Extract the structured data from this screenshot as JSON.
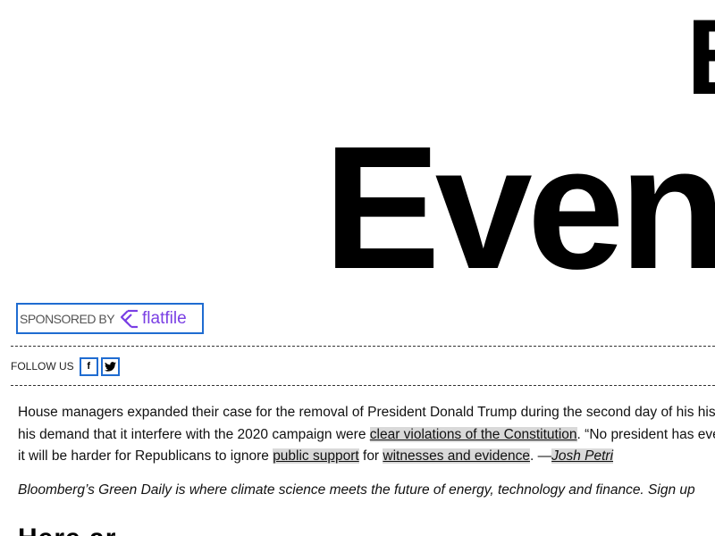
{
  "masthead": {
    "top_word": "B",
    "main_word": "Eveni"
  },
  "sponsor": {
    "label": "SPONSORED BY",
    "brand": "flatfile",
    "logo_icon": "flatfile-layers-icon",
    "border_color": "#1f6cd1",
    "brand_color": "#7a3fe4"
  },
  "follow": {
    "label": "FOLLOW US",
    "facebook_glyph": "f",
    "twitter_icon": "twitter-bird-icon"
  },
  "article": {
    "line1": "House managers expanded their case for the removal of President Donald Trump during the second day of his his",
    "line2_pre": "his demand that it interfere with the 2020 campaign were ",
    "line2_link": "clear violations of the Constitution",
    "line2_post": ". “No president has eve",
    "line3_pre": "it will be harder for Republicans to ignore ",
    "line3_link1": "public support",
    "line3_mid": " for ",
    "line3_link2": "witnesses and evidence",
    "line3_dash": ". —",
    "line3_author": "Josh Petri"
  },
  "promo": {
    "text": "Bloomberg’s Green Daily is where climate science meets the future of energy, technology and finance. Sign up"
  },
  "next_heading": {
    "text": "Here ar"
  }
}
